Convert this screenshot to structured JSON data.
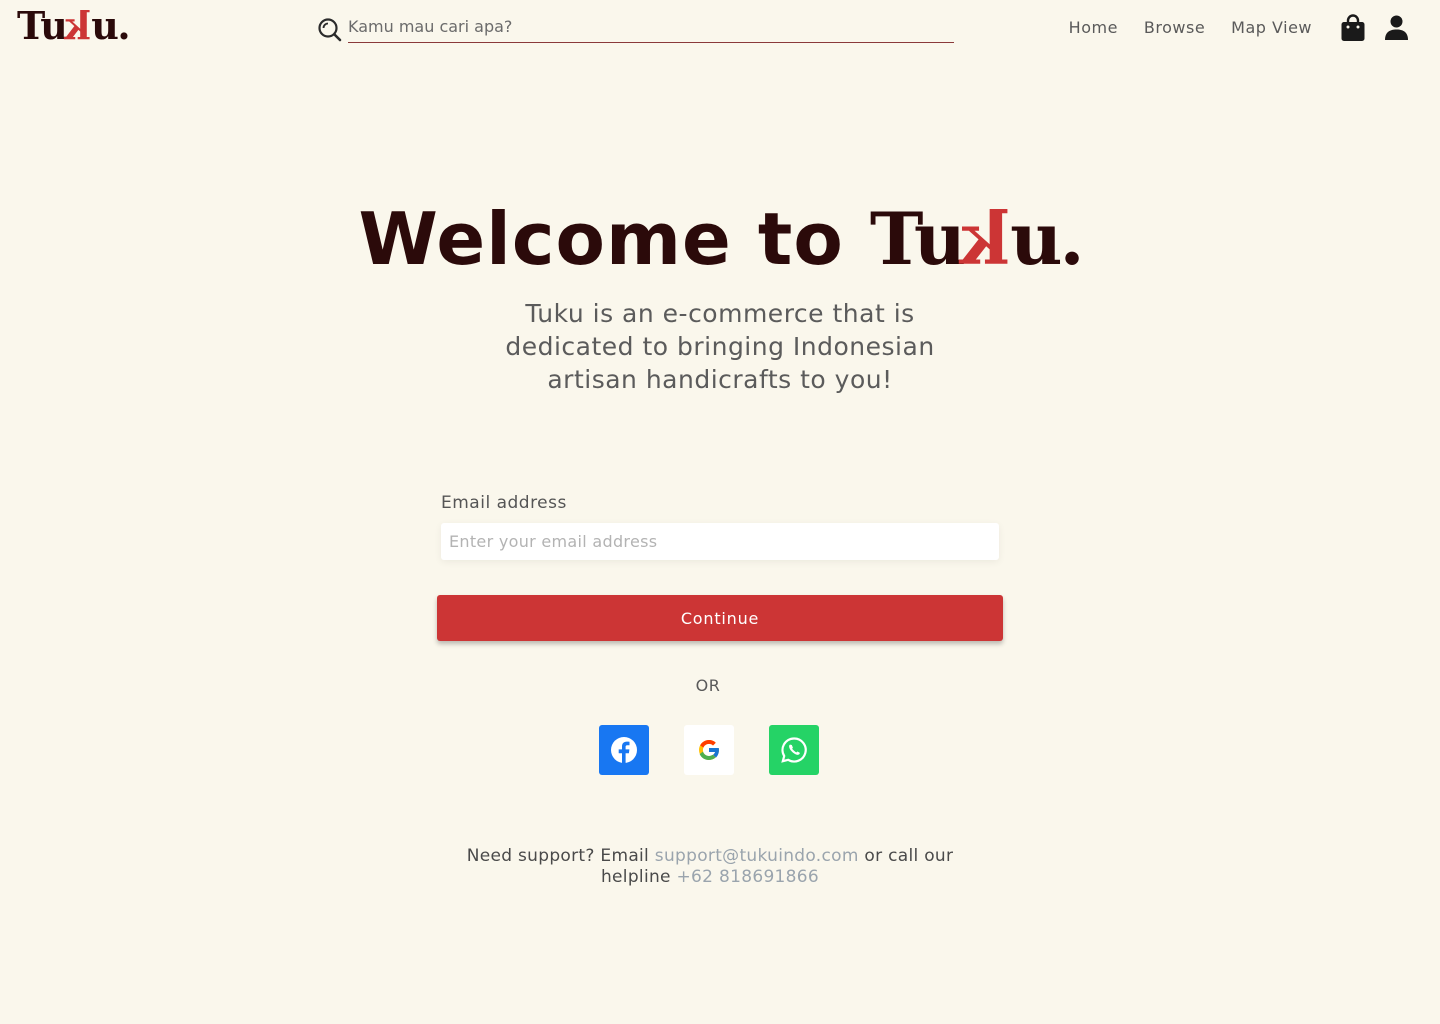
{
  "header": {
    "logo": {
      "before": "Tu",
      "k": "k",
      "after": "u."
    },
    "search": {
      "placeholder": "Kamu mau cari apa?"
    },
    "nav": [
      {
        "label": "Home"
      },
      {
        "label": "Browse"
      },
      {
        "label": "Map View"
      }
    ],
    "icons": {
      "search": "search-icon",
      "cart": "shopping-bag-icon",
      "user": "user-icon"
    }
  },
  "hero": {
    "title_prefix": "Welcome to ",
    "brand_before": "Tu",
    "brand_k": "k",
    "brand_after": "u.",
    "subtitle": "Tuku is an e-commerce that is dedicated to bringing Indonesian artisan handicrafts to you!"
  },
  "form": {
    "email_label": "Email address",
    "email_placeholder": "Enter your email address",
    "continue_label": "Continue",
    "or_label": "OR"
  },
  "social": [
    {
      "name": "facebook",
      "icon": "facebook-icon",
      "color": "#1877f2"
    },
    {
      "name": "google",
      "icon": "google-icon",
      "color": "#ffffff"
    },
    {
      "name": "whatsapp",
      "icon": "whatsapp-icon",
      "color": "#25d366"
    }
  ],
  "support": {
    "text1": "Need support? Email ",
    "email": "support@tukuindo.com",
    "text2": " or call our helpline ",
    "phone": "+62 818691866"
  },
  "colors": {
    "background": "#faf7ec",
    "brand_dark": "#2b0a0a",
    "accent": "#cc3535",
    "link": "#9aa4ad"
  }
}
